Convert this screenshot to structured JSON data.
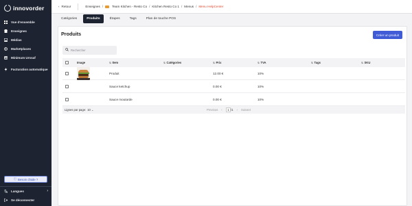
{
  "sidebar": {
    "logo": "innovorder",
    "items": [
      {
        "label": "Vue d'ensemble",
        "icon": "grid-icon"
      },
      {
        "label": "Enseignes",
        "icon": "store-icon"
      },
      {
        "label": "Médias",
        "icon": "image-icon"
      },
      {
        "label": "Marketplaces",
        "icon": "globe-icon"
      },
      {
        "label": "Minimum Urssaf",
        "icon": "chart-icon"
      }
    ],
    "items2": [
      {
        "label": "Facturation automatique",
        "icon": "bolt-icon"
      }
    ],
    "help_label": "Besoin d'aide ?",
    "language_label": "Langues",
    "logout_label": "Se déconnecter"
  },
  "topbar": {
    "back_label": "Retour",
    "breadcrumb": [
      "Enseignes",
      "Team Kitchen - Resto Co",
      "Kitchen Resto Co 1",
      "Menus",
      "Menu HelpCenter"
    ]
  },
  "tabs": [
    "Catégories",
    "Produits",
    "Étapes",
    "Tags",
    "Plan de touche POS"
  ],
  "active_tab": "Produits",
  "panel": {
    "title": "Produits",
    "create_label": "Créer un produit",
    "search_placeholder": "Rechercher"
  },
  "table": {
    "headers": {
      "image": "Image",
      "item": "Item",
      "categories": "Catégories",
      "price": "Prix",
      "tva": "TVA",
      "tags": "Tags",
      "sku": "SKU"
    },
    "rows": [
      {
        "has_image": true,
        "item": "Produit",
        "categories": "",
        "price": "12.00 €",
        "tva": "10%",
        "tags": "",
        "sku": ""
      },
      {
        "has_image": false,
        "item": "Sauce ketchup",
        "categories": "",
        "price": "0.00 €",
        "tva": "10%",
        "tags": "",
        "sku": ""
      },
      {
        "has_image": false,
        "item": "Sauce moutarde",
        "categories": "",
        "price": "0.00 €",
        "tva": "10%",
        "tags": "",
        "sku": ""
      }
    ],
    "footer": {
      "rows_per_page_label": "Lignes par page:",
      "rows_per_page": "10",
      "prev_label": "Previous",
      "page_current": "1",
      "page_total": "/1",
      "next_label": "Suivant"
    }
  },
  "colors": {
    "sidebar_bg": "#1d2330",
    "primary": "#3f5bd6",
    "breadcrumb_active": "#e04a2f"
  }
}
